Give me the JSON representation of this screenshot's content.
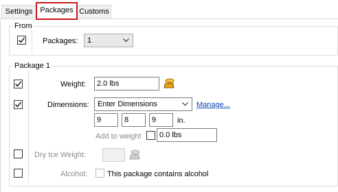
{
  "tabs": [
    {
      "label": "Settings"
    },
    {
      "label": "Packages"
    },
    {
      "label": "Customs"
    }
  ],
  "from_group": {
    "legend": "From",
    "packages_label": "Packages:",
    "packages_value": "1"
  },
  "package_group": {
    "legend": "Package 1",
    "weight_label": "Weight:",
    "weight_value": "2.0 lbs",
    "dimensions_label": "Dimensions:",
    "dimensions_value": "Enter Dimensions",
    "manage_link": "Manage...",
    "dim_length": "9",
    "dim_width": "8",
    "dim_height": "9",
    "dim_unit": "in.",
    "add_to_weight_label": "Add to weight",
    "add_to_weight_value": "0.0 lbs",
    "dry_ice_label": "Dry Ice Weight:",
    "dry_ice_value": "",
    "alcohol_label": "Alcohol:",
    "alcohol_checkbox_label": "This package contains alcohol"
  },
  "icons": {
    "scale": "scale-icon",
    "scale_disabled": "scale-icon-disabled"
  },
  "colors": {
    "active_tab_border": "#c8161d",
    "link": "#0645ad",
    "scale_icon": "#e8a317"
  }
}
